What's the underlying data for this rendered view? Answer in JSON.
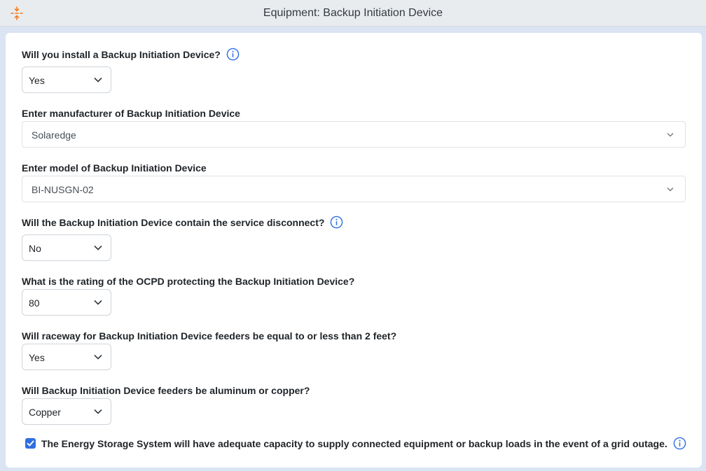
{
  "window": {
    "title": "Equipment: Backup Initiation Device",
    "accent_color": "#f57c1f",
    "icon": "collapse-arrows-icon"
  },
  "form": {
    "q1": {
      "label": "Will you install a Backup Initiation Device?",
      "value": "Yes",
      "has_info": true
    },
    "q2": {
      "label": "Enter manufacturer of Backup Initiation Device",
      "value": "Solaredge"
    },
    "q3": {
      "label": "Enter model of Backup Initiation Device",
      "value": "BI-NUSGN-02"
    },
    "q4": {
      "label": "Will the Backup Initiation Device contain the service disconnect?",
      "value": "No",
      "has_info": true
    },
    "q5": {
      "label": "What is the rating of the OCPD protecting the Backup Initiation Device?",
      "value": "80"
    },
    "q6": {
      "label": "Will raceway for Backup Initiation Device feeders be equal to or less than 2 feet?",
      "value": "Yes"
    },
    "q7": {
      "label": "Will Backup Initiation Device feeders be aluminum or copper?",
      "value": "Copper"
    },
    "ess_check": {
      "label": "The Energy Storage System will have adequate capacity to supply connected equipment or backup loads in the event of a grid outage.",
      "checked": true
    }
  },
  "colors": {
    "info_icon": "#2f6fe0",
    "checkbox": "#2f6fe0"
  }
}
